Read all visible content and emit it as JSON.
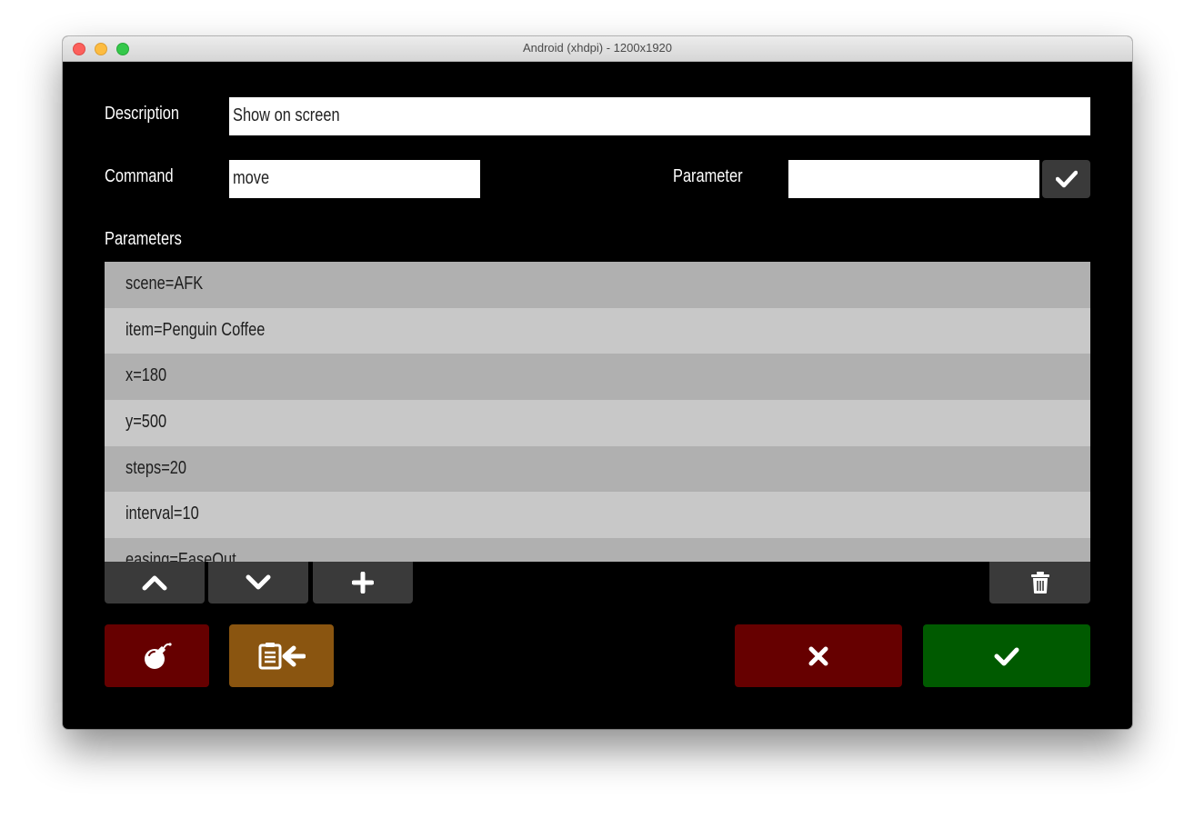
{
  "window": {
    "title": "Android (xhdpi) - 1200x1920"
  },
  "form": {
    "description_label": "Description",
    "description_value": "Show on screen",
    "command_label": "Command",
    "command_value": "move",
    "parameter_label": "Parameter",
    "parameter_value": "",
    "parameters_label": "Parameters"
  },
  "parameters": [
    "scene=AFK",
    "item=Penguin Coffee",
    "x=180",
    "y=500",
    "steps=20",
    "interval=10",
    "easing=EaseOut"
  ],
  "icons": {
    "confirm_parameter": "check-icon",
    "move_up": "chevron-up-icon",
    "move_down": "chevron-down-icon",
    "add": "plus-icon",
    "delete": "trash-icon",
    "bomb": "bomb-icon",
    "import": "clipboard-arrow-left-icon",
    "cancel": "close-icon",
    "ok": "check-icon"
  },
  "colors": {
    "background": "#000000",
    "dark_button": "#3a3a3a",
    "danger": "#660000",
    "import": "#8a5510",
    "ok": "#005a00",
    "list_odd": "#b0b0b0",
    "list_even": "#c8c8c8"
  }
}
